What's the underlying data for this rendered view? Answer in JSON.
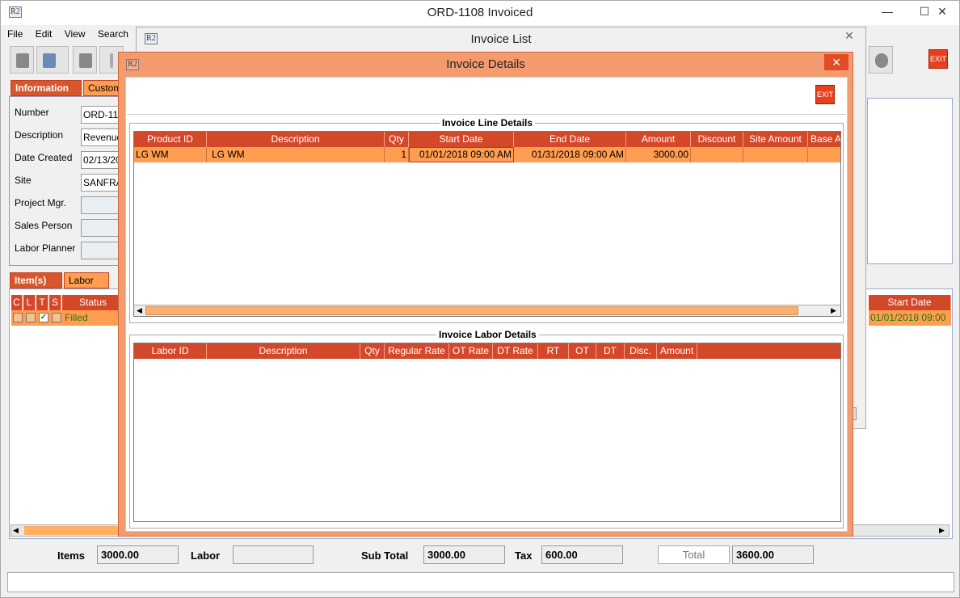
{
  "main": {
    "title": "ORD-1108 Invoiced",
    "icon": "R2",
    "menu": [
      "File",
      "Edit",
      "View",
      "Search"
    ],
    "tabs_top": [
      {
        "label": "Information"
      },
      {
        "label": "Custom"
      }
    ],
    "form": {
      "labels": [
        "Number",
        "Description",
        "Date Created",
        "Site",
        "Project Mgr.",
        "Sales Person",
        "Labor Planner"
      ],
      "values": [
        "ORD-11",
        "Revenue",
        "02/13/20",
        "SANFRA",
        "",
        "",
        ""
      ]
    },
    "tabs_bottom": [
      {
        "label": "Item(s)"
      },
      {
        "label": "Labor"
      }
    ],
    "items_headers": [
      "C",
      "L",
      "T",
      "S",
      "Status"
    ],
    "items_row_status": "Filled",
    "right_header": "Start Date",
    "right_value": "01/01/2018 09:00",
    "totals": {
      "items_label": "Items",
      "items_value": "3000.00",
      "labor_label": "Labor",
      "labor_value": "",
      "subtotal_label": "Sub Total",
      "subtotal_value": "3000.00",
      "tax_label": "Tax",
      "tax_value": "600.00",
      "total_label": "Total",
      "total_value": "3600.00"
    },
    "exit_label": "EXIT"
  },
  "invoice_list": {
    "title": "Invoice List",
    "icon": "R2",
    "close": "✕"
  },
  "invoice_details": {
    "title": "Invoice Details",
    "icon": "R2",
    "close": "✕",
    "exit_label": "EXIT",
    "line_details": {
      "title": "Invoice Line Details",
      "headers": [
        "Product ID",
        "Description",
        "Qty",
        "Start Date",
        "End Date",
        "Amount",
        "Discount",
        "Site Amount",
        "Base A"
      ],
      "rows": [
        [
          "LG WM",
          "LG WM",
          "1",
          "01/01/2018 09:00 AM",
          "01/31/2018 09:00 AM",
          "3000.00",
          "",
          "",
          ""
        ]
      ]
    },
    "labor_details": {
      "title": "Invoice Labor Details",
      "headers": [
        "Labor ID",
        "Description",
        "Qty",
        "Regular Rate",
        "OT Rate",
        "DT Rate",
        "RT",
        "OT",
        "DT",
        "Disc.",
        "Amount"
      ]
    }
  }
}
